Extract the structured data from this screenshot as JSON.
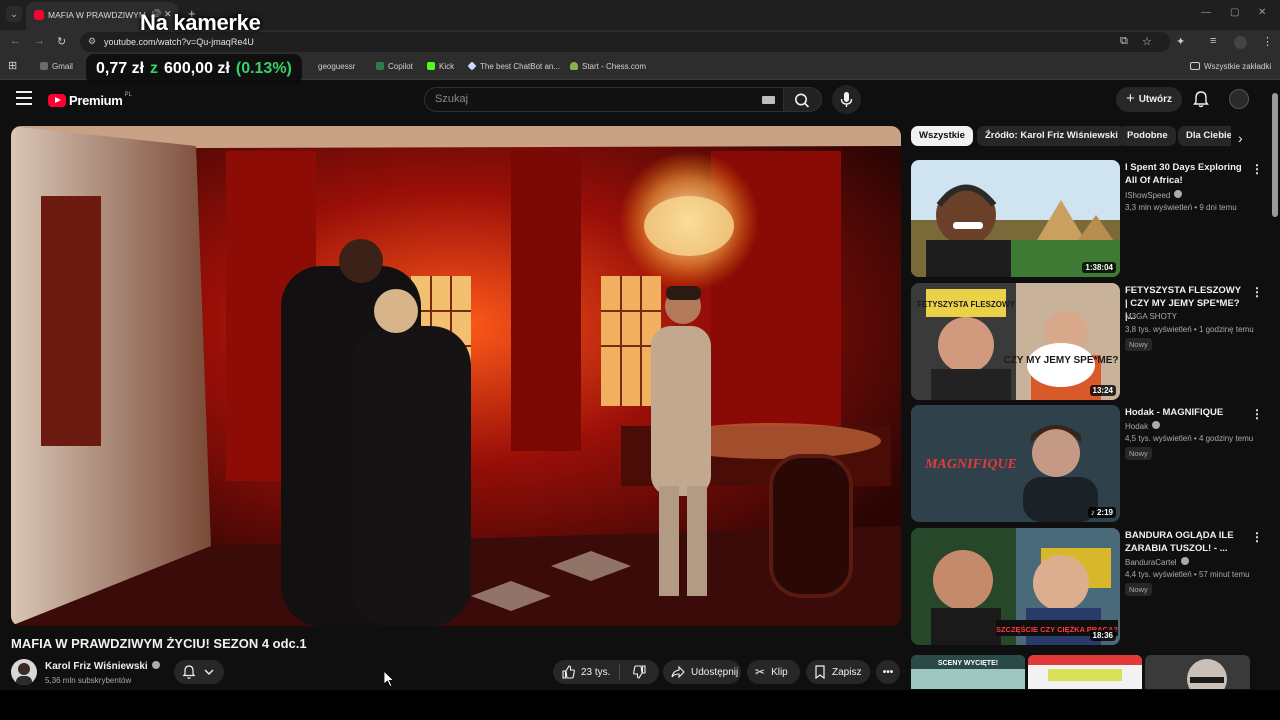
{
  "browser": {
    "tab_title": "MAFIA W PRAWDZIWYM Ż",
    "url": "youtube.com/watch?v=Qu-jmaqRe4U",
    "bookmarks": [
      {
        "label": "Gmail"
      },
      {
        "label": "geoguessr"
      },
      {
        "label": "Copilot"
      },
      {
        "label": "Kick"
      },
      {
        "label": "The best ChatBot an..."
      },
      {
        "label": "Start - Chess.com"
      }
    ],
    "all_bookmarks": "Wszystkie zakładki"
  },
  "overlay": {
    "title": "Na kamerke",
    "ticker_left": "0,77 zł",
    "ticker_z": "z",
    "ticker_right": "600,00 zł",
    "ticker_pct": "(0.13%)"
  },
  "header": {
    "logo": "Premium",
    "logo_country": "PL",
    "search_placeholder": "Szukaj",
    "create": "Utwórz"
  },
  "video": {
    "title": "MAFIA W PRAWDZIWYM ŻYCIU! SEZON 4 odc.1",
    "channel": "Karol Friz Wiśniewski",
    "subscribers": "5,36 mln subskrybentów",
    "likes": "23 tys.",
    "share": "Udostępnij",
    "clip": "Klip",
    "save": "Zapisz"
  },
  "chips": [
    "Wszystkie",
    "Źródło: Karol Friz Wiśniewski",
    "Podobne",
    "Dla Ciebie"
  ],
  "recommendations": [
    {
      "title": "I Spent 30 Days Exploring All Of Africa!",
      "channel": "IShowSpeed",
      "verified": true,
      "meta": "3,3 mln wyświetleń • 9 dni temu",
      "duration": "1:38:04",
      "badge": ""
    },
    {
      "title": "FETYSZYSTA FLESZOWY | CZY MY JEMY SPE*ME? |...",
      "channel": "M3GA SHOTY",
      "verified": false,
      "meta": "3,8 tys. wyświetleń • 1 godzinę temu",
      "duration": "13:24",
      "badge": "Nowy"
    },
    {
      "title": "Hodak - MAGNIFIQUE",
      "channel": "Hodak",
      "verified": true,
      "meta": "4,5 tys. wyświetleń • 4 godziny temu",
      "duration": "2:19",
      "badge": "Nowy"
    },
    {
      "title": "BANDURA OGLĄDA ILE ZARABIA TUSZOL! - ...",
      "channel": "BanduraCartel",
      "verified": true,
      "meta": "4,4 tys. wyświetleń • 57 minut temu",
      "duration": "18:36",
      "badge": "Nowy"
    }
  ],
  "thumb_text": {
    "fleszowy": "FETYSZYSTA FLESZOWY",
    "czymy": "CZY MY JEMY SPE*ME?",
    "magnifique": "MAGNIFIQUE",
    "bandura": "SZCZĘŚCIE CZY CIĘŻKA PRACA?",
    "shorts1": "SCENY WYCIĘTE!"
  },
  "colors": {
    "brand_red": "#ff0033",
    "background": "#0f0f0f",
    "pill": "#272727",
    "ticker_green": "#36d16a"
  }
}
